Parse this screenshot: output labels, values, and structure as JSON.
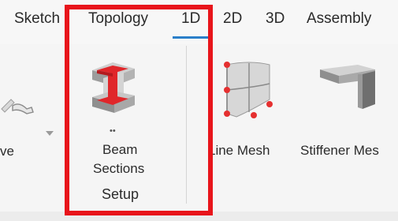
{
  "tabs": [
    {
      "label": "Sketch"
    },
    {
      "label": "Topology"
    },
    {
      "label": "1D",
      "active": true
    },
    {
      "label": "2D"
    },
    {
      "label": "3D"
    },
    {
      "label": "Assembly"
    }
  ],
  "ribbon": {
    "partial_left_label": "ve",
    "beam_sections": {
      "dots": "••",
      "line1": "Beam",
      "line2": "Sections",
      "group_label": "Setup"
    },
    "line_mesh_label": "Line Mesh",
    "stiffener_label": "Stiffener Mes"
  },
  "colors": {
    "highlight": "#e8151b",
    "active_tab_underline": "#2a7fc9",
    "beam_icon_red": "#e0262a"
  },
  "icons": {
    "partial_left": "tool-icon",
    "beam_sections": "beam-sections-icon",
    "line_mesh": "line-mesh-icon",
    "stiffener_mesh": "stiffener-mesh-icon"
  }
}
